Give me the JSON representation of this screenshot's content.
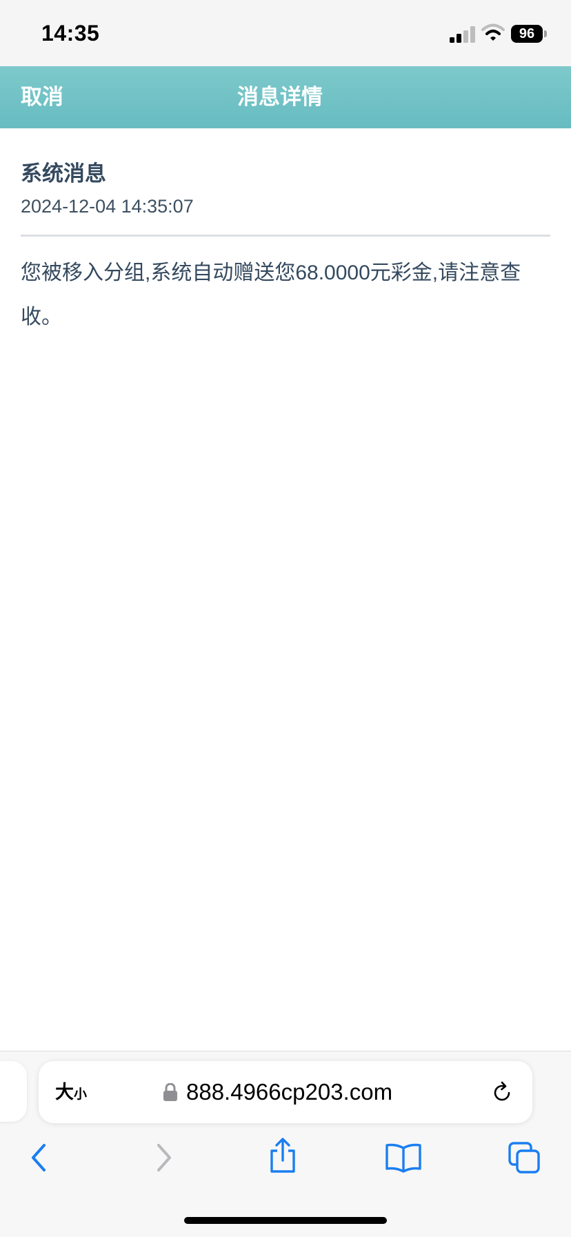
{
  "status_bar": {
    "time": "14:35",
    "battery": "96",
    "icons": [
      "signal-icon",
      "wifi-icon",
      "battery-icon"
    ]
  },
  "header": {
    "cancel_label": "取消",
    "title": "消息详情",
    "accent_color": "#6cc0c4"
  },
  "message": {
    "title": "系统消息",
    "timestamp": "2024-12-04 14:35:07",
    "body": "您被移入分组,系统自动赠送您68.0000元彩金,请注意查收。"
  },
  "browser": {
    "text_size_big": "大",
    "text_size_small": "小",
    "url": "888.4966cp203.com",
    "icons": [
      "lock-icon",
      "reload-icon",
      "back-icon",
      "forward-icon",
      "share-icon",
      "bookmarks-icon",
      "tabs-icon"
    ],
    "accent_color": "#1a7ef0"
  }
}
